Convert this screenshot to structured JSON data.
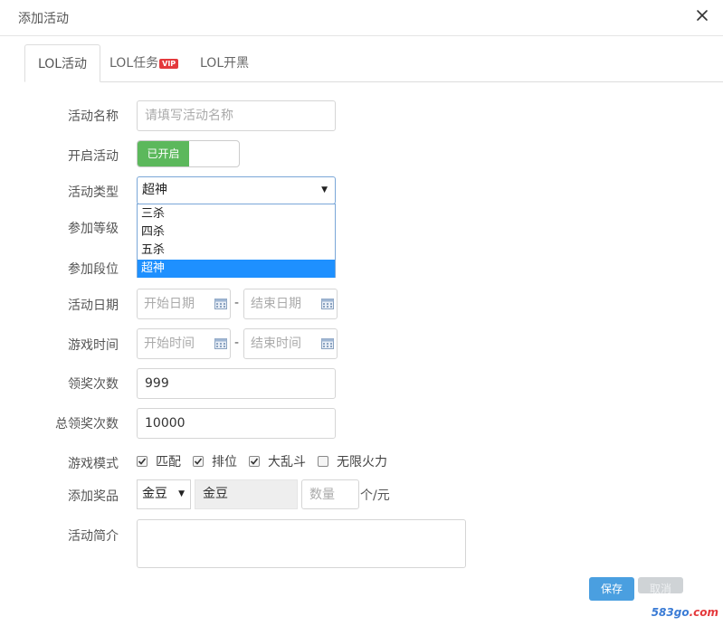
{
  "dialog": {
    "title": "添加活动"
  },
  "tabs": [
    {
      "label": "LOL活动",
      "active": true
    },
    {
      "label": "LOL任务",
      "badge": "VIP"
    },
    {
      "label": "LOL开黑"
    }
  ],
  "form": {
    "name": {
      "label": "活动名称",
      "placeholder": "请填写活动名称",
      "value": ""
    },
    "enable": {
      "label": "开启活动",
      "on_text": "已开启"
    },
    "type": {
      "label": "活动类型",
      "selected": "超神",
      "options": [
        "三杀",
        "四杀",
        "五杀",
        "超神"
      ]
    },
    "level": {
      "label": "参加等级"
    },
    "rank": {
      "label": "参加段位"
    },
    "date": {
      "label": "活动日期",
      "start_placeholder": "开始日期",
      "end_placeholder": "结束日期",
      "separator": "-"
    },
    "time": {
      "label": "游戏时间",
      "start_placeholder": "开始时间",
      "end_placeholder": "结束时间",
      "separator": "-"
    },
    "claim_count": {
      "label": "领奖次数",
      "value": "999"
    },
    "total_claim_count": {
      "label": "总领奖次数",
      "value": "10000"
    },
    "modes": {
      "label": "游戏模式",
      "items": [
        {
          "label": "匹配",
          "checked": true
        },
        {
          "label": "排位",
          "checked": true
        },
        {
          "label": "大乱斗",
          "checked": true
        },
        {
          "label": "无限火力",
          "checked": false
        }
      ]
    },
    "prize": {
      "label": "添加奖品",
      "selected": "金豆",
      "readonly_value": "金豆",
      "qty_placeholder": "数量",
      "unit": "个/元"
    },
    "intro": {
      "label": "活动简介",
      "value": ""
    }
  },
  "buttons": {
    "save": "保存",
    "cancel": "取消"
  },
  "watermark": {
    "prefix": "583go",
    "suffix": ".com"
  },
  "colors": {
    "toggle_on": "#5cb85c",
    "primary": "#4a9fe0",
    "option_selected": "#1e90ff",
    "vip_badge": "#e4393c"
  }
}
